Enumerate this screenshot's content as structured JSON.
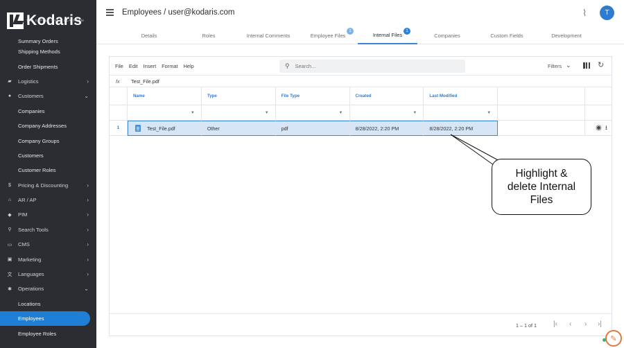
{
  "brand": {
    "name": "Kodaris",
    "tagline": "THE SUPPLY CHAIN PLATFORM"
  },
  "sidebar": {
    "items": [
      {
        "label": "Summary Orders",
        "kind": "sub"
      },
      {
        "label": "Shipping Methods",
        "kind": "sub"
      },
      {
        "label": "Order Shipments",
        "kind": "sub"
      },
      {
        "label": "Logistics",
        "kind": "top",
        "icon": "truck-icon",
        "chevron": "›"
      },
      {
        "label": "Customers",
        "kind": "top",
        "icon": "users-icon",
        "chevron": "⌄"
      },
      {
        "label": "Companies",
        "kind": "sub"
      },
      {
        "label": "Company Addresses",
        "kind": "sub"
      },
      {
        "label": "Company Groups",
        "kind": "sub"
      },
      {
        "label": "Customers",
        "kind": "sub"
      },
      {
        "label": "Customer Roles",
        "kind": "sub"
      },
      {
        "label": "Pricing & Discounting",
        "kind": "top",
        "icon": "dollar-icon",
        "chevron": "›"
      },
      {
        "label": "AR / AP",
        "kind": "top",
        "icon": "bank-icon",
        "chevron": "›"
      },
      {
        "label": "PIM",
        "kind": "top",
        "icon": "tag-icon",
        "chevron": "›"
      },
      {
        "label": "Search Tools",
        "kind": "top",
        "icon": "search-icon",
        "chevron": "›"
      },
      {
        "label": "CMS",
        "kind": "top",
        "icon": "window-icon",
        "chevron": "›"
      },
      {
        "label": "Marketing",
        "kind": "top",
        "icon": "id-card-icon",
        "chevron": "›"
      },
      {
        "label": "Languages",
        "kind": "top",
        "icon": "translate-icon",
        "chevron": "›"
      },
      {
        "label": "Operations",
        "kind": "top",
        "icon": "gear-icon",
        "chevron": "⌄"
      },
      {
        "label": "Locations",
        "kind": "sub"
      },
      {
        "label": "Employees",
        "kind": "sub",
        "active": true
      },
      {
        "label": "Employee Roles",
        "kind": "sub"
      }
    ]
  },
  "header": {
    "title": "Employees / user@kodaris.com",
    "avatar_initial": "T",
    "tabs": [
      {
        "label": "Details",
        "badge": ""
      },
      {
        "label": "Roles",
        "badge": ""
      },
      {
        "label": "Internal Comments",
        "badge": ""
      },
      {
        "label": "Employee Files",
        "badge": "1"
      },
      {
        "label": "Internal Files",
        "badge": "1",
        "active": true
      },
      {
        "label": "Companies",
        "badge": ""
      },
      {
        "label": "Custom Fields",
        "badge": ""
      },
      {
        "label": "Development",
        "badge": ""
      }
    ]
  },
  "toolbar": {
    "menu": [
      "File",
      "Edit",
      "Insert",
      "Format",
      "Help"
    ],
    "search_placeholder": "Search...",
    "filters_label": "Filters"
  },
  "formula_bar": {
    "fx": "fx",
    "value": "Test_File.pdf"
  },
  "table": {
    "columns": [
      "Name",
      "Type",
      "File Type",
      "Created",
      "Last Modified"
    ],
    "rows": [
      {
        "num": "1",
        "name": "Test_File.pdf",
        "type": "Other",
        "file_type": "pdf",
        "created": "8/28/2022, 2:20 PM",
        "last_modified": "8/28/2022, 2:20 PM"
      }
    ]
  },
  "pager": {
    "text": "1 – 1 of 1"
  },
  "callout": {
    "text": "Highlight & delete Internal Files"
  },
  "colors": {
    "accent": "#2f7bd2",
    "sidebar_bg": "#2b2d33",
    "active_item": "#1f7fd6",
    "selection": "#d7e6f7"
  }
}
